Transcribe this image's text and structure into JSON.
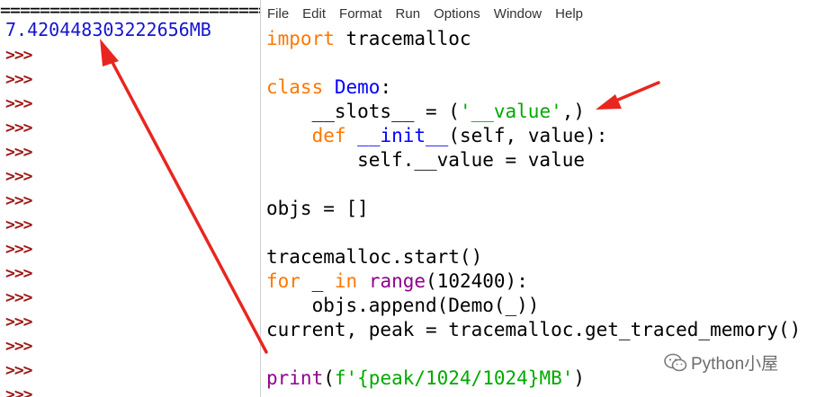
{
  "shell": {
    "separator": "================================",
    "result": "7.420448303222656MB",
    "prompts": [
      ">>>",
      ">>>",
      ">>>",
      ">>>",
      ">>>",
      ">>>",
      ">>>",
      ">>>",
      ">>>",
      ">>>",
      ">>>",
      ">>>",
      ">>>",
      ">>>",
      ">>>"
    ]
  },
  "editor": {
    "menu": [
      "File",
      "Edit",
      "Format",
      "Run",
      "Options",
      "Window",
      "Help"
    ],
    "code_lines": [
      [
        {
          "t": "import",
          "c": "kw"
        },
        {
          "t": " tracemalloc",
          "c": ""
        }
      ],
      [],
      [
        {
          "t": "class",
          "c": "kw"
        },
        {
          "t": " ",
          "c": ""
        },
        {
          "t": "Demo",
          "c": "def"
        },
        {
          "t": ":",
          "c": ""
        }
      ],
      [
        {
          "t": "    __slots__ = (",
          "c": ""
        },
        {
          "t": "'__value'",
          "c": "str"
        },
        {
          "t": ",)",
          "c": ""
        }
      ],
      [
        {
          "t": "    ",
          "c": ""
        },
        {
          "t": "def",
          "c": "kw"
        },
        {
          "t": " ",
          "c": ""
        },
        {
          "t": "__init__",
          "c": "def"
        },
        {
          "t": "(self, value):",
          "c": ""
        }
      ],
      [
        {
          "t": "        self.__value = value",
          "c": ""
        }
      ],
      [],
      [
        {
          "t": "objs = []",
          "c": ""
        }
      ],
      [],
      [
        {
          "t": "tracemalloc.start()",
          "c": ""
        }
      ],
      [
        {
          "t": "for",
          "c": "kw"
        },
        {
          "t": " _ ",
          "c": ""
        },
        {
          "t": "in",
          "c": "kw"
        },
        {
          "t": " ",
          "c": ""
        },
        {
          "t": "range",
          "c": "bi"
        },
        {
          "t": "(102400):",
          "c": ""
        }
      ],
      [
        {
          "t": "    objs.append(Demo(_))",
          "c": ""
        }
      ],
      [
        {
          "t": "current, peak = tracemalloc.get_traced_memory()",
          "c": ""
        }
      ],
      [],
      [
        {
          "t": "print",
          "c": "bi"
        },
        {
          "t": "(",
          "c": ""
        },
        {
          "t": "f'{peak/1024/1024}MB'",
          "c": "str"
        },
        {
          "t": ")",
          "c": ""
        }
      ]
    ]
  },
  "watermark": {
    "text": "Python小屋",
    "icon": "wechat-icon"
  },
  "colors": {
    "keyword": "#ff7700",
    "definition": "#0000ff",
    "string": "#00aa00",
    "builtin": "#900090",
    "result": "#1515cc",
    "prompt": "#a01818",
    "annotation_arrow": "#e8261f"
  }
}
